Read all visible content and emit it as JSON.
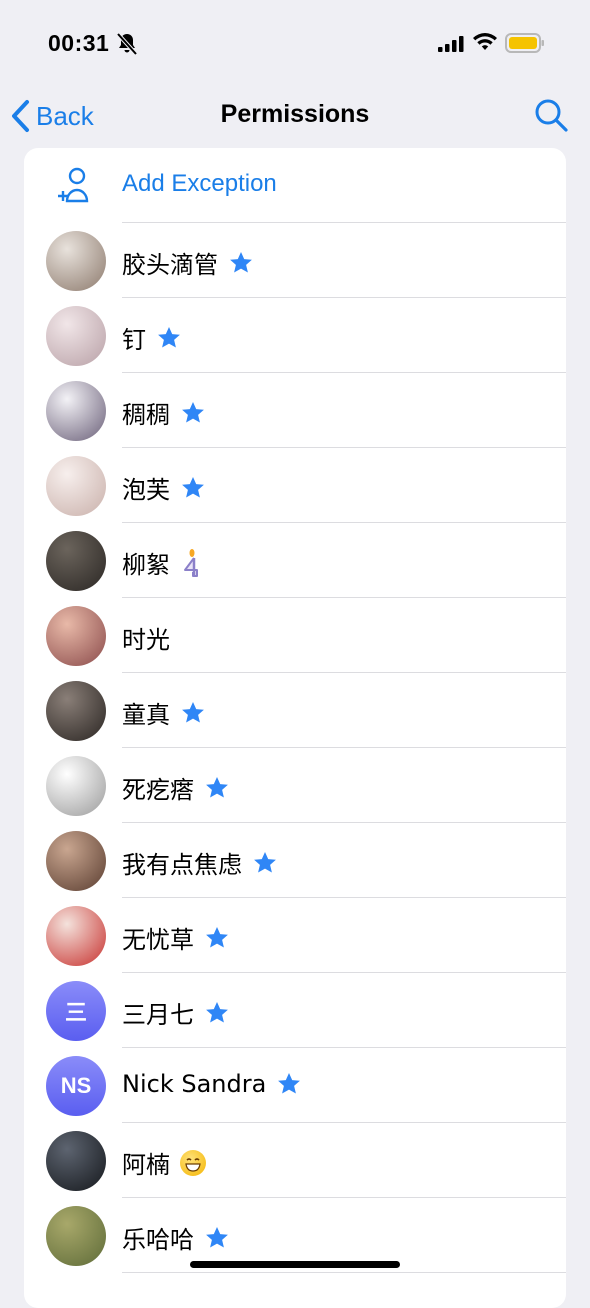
{
  "status_bar": {
    "time": "00:31"
  },
  "nav": {
    "back_label": "Back",
    "title": "Permissions"
  },
  "add_exception": {
    "label": "Add Exception"
  },
  "contacts": [
    {
      "name": "胶头滴管",
      "badge": "star-icon",
      "avatar_colors": [
        "#e8e2dc",
        "#8d7a6d"
      ]
    },
    {
      "name": "钉",
      "badge": "star-icon",
      "avatar_colors": [
        "#f1e6e8",
        "#b8a0a6"
      ]
    },
    {
      "name": "稠稠",
      "badge": "star-icon",
      "avatar_colors": [
        "#f3f2f6",
        "#6a5f78"
      ]
    },
    {
      "name": "泡芙",
      "badge": "star-icon",
      "avatar_colors": [
        "#f7efed",
        "#c9b0aa"
      ]
    },
    {
      "name": "柳絮",
      "badge": "candle-4-icon",
      "avatar_colors": [
        "#6b645c",
        "#2b2724"
      ]
    },
    {
      "name": "时光",
      "badge": "",
      "avatar_colors": [
        "#e8b9a8",
        "#8a4a4a"
      ]
    },
    {
      "name": "童真",
      "badge": "star-icon",
      "avatar_colors": [
        "#8a7f78",
        "#2a2522"
      ]
    },
    {
      "name": "死疙瘩",
      "badge": "star-icon",
      "avatar_colors": [
        "#ffffff",
        "#9a9a9a"
      ]
    },
    {
      "name": "我有点焦虑",
      "badge": "star-icon",
      "avatar_colors": [
        "#c9a690",
        "#5a3d30"
      ]
    },
    {
      "name": "无忧草",
      "badge": "star-icon",
      "avatar_colors": [
        "#f4e2dc",
        "#c7312e"
      ]
    },
    {
      "name": "三月七",
      "badge": "star-icon",
      "initials": "三"
    },
    {
      "name": "Nick Sandra",
      "badge": "star-icon",
      "initials": "NS"
    },
    {
      "name": "阿楠",
      "badge": "grinning-emoji-icon",
      "avatar_colors": [
        "#5d6470",
        "#15181c"
      ]
    },
    {
      "name": "乐哈哈",
      "badge": "star-icon",
      "avatar_colors": [
        "#a8a86a",
        "#5e6b38"
      ]
    }
  ],
  "colors": {
    "accent": "#1a7ee8",
    "background": "#efeff4",
    "star": "#2f86f6"
  }
}
